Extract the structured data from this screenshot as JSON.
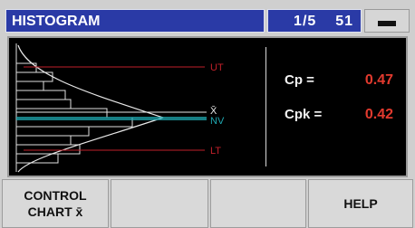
{
  "titlebar": {
    "title": "HISTOGRAM",
    "page": "1/5",
    "count": "51",
    "menu_icon": "minimize-bar-icon"
  },
  "histogram": {
    "ut_label": "UT",
    "xbar_label": "X̄",
    "nv_label": "NV",
    "lt_label": "LT",
    "colors": {
      "limits": "#c0202a",
      "nominal": "#1fa7b0",
      "axis": "#e0e0e0"
    }
  },
  "stats": {
    "cp_label": "Cp  =",
    "cp_value": "0.47",
    "cpk_label": "Cpk =",
    "cpk_value": "0.42"
  },
  "softkeys": {
    "control_chart_line1": "CONTROL",
    "control_chart_line2": "CHART x̄",
    "key2": "",
    "key3": "",
    "help": "HELP"
  }
}
